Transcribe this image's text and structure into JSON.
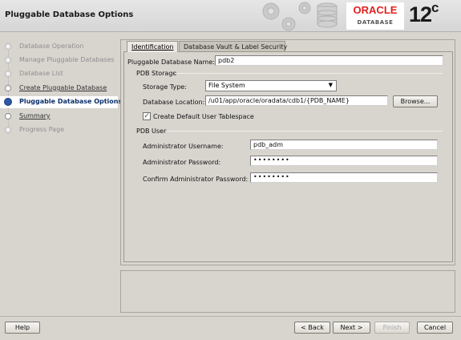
{
  "header": {
    "title": "Pluggable Database Options",
    "logo": {
      "brand": "ORACLE",
      "product": "DATABASE",
      "version": "12",
      "version_suffix": "c"
    }
  },
  "sidebar": {
    "steps": [
      {
        "label": "Database Operation",
        "state": "done"
      },
      {
        "label": "Manage Pluggable Databases",
        "state": "done"
      },
      {
        "label": "Database List",
        "state": "done"
      },
      {
        "label": "Create Pluggable Database",
        "state": "link"
      },
      {
        "label": "Pluggable Database Options",
        "state": "current"
      },
      {
        "label": "Summary",
        "state": "link"
      },
      {
        "label": "Progress Page",
        "state": "pending"
      }
    ]
  },
  "tabs": [
    {
      "label": "Identification",
      "active": true
    },
    {
      "label": "Database Vault & Label Security",
      "active": false
    }
  ],
  "form": {
    "pdb_name_label": "Pluggable Database Name:",
    "pdb_name_value": "pdb2",
    "storage_group_title": "PDB Storage",
    "storage_type_label": "Storage Type:",
    "storage_type_value": "File System",
    "db_location_label": "Database Location:",
    "db_location_value": "/u01/app/oracle/oradata/cdb1/{PDB_NAME}",
    "browse_label": "Browse...",
    "default_tablespace_label": "Create Default User Tablespace",
    "default_tablespace_checked": true,
    "user_group_title": "PDB User",
    "admin_username_label": "Administrator Username:",
    "admin_username_value": "pdb_adm",
    "admin_password_label": "Administrator Password:",
    "admin_password_value": "••••••••",
    "confirm_password_label": "Confirm Administrator Password:",
    "confirm_password_value": "••••••••"
  },
  "footer": {
    "help": "Help",
    "back": "< Back",
    "next": "Next >",
    "finish": "Finish",
    "cancel": "Cancel"
  },
  "colors": {
    "background": "#d8d5cf",
    "current_step_bullet": "#2d58a7",
    "oracle_red": "#e2201f"
  }
}
